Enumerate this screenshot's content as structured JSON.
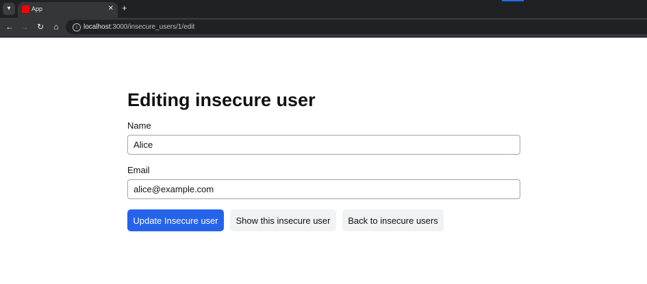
{
  "browser": {
    "tab_menu_icon": "chevron-down-icon",
    "tab_title": "App",
    "tab_close": "✕",
    "new_tab": "+",
    "url_host": "localhost",
    "url_path": ":3000/insecure_users/1/edit",
    "colors": {
      "favicon": "#ff0000",
      "tabbar_bg": "#202124",
      "toolbar_bg": "#35363a"
    }
  },
  "page": {
    "title": "Editing insecure user",
    "form": {
      "name_label": "Name",
      "name_value": "Alice",
      "email_label": "Email",
      "email_value": "alice@example.com"
    },
    "buttons": {
      "update": "Update Insecure user",
      "show": "Show this insecure user",
      "back": "Back to insecure users"
    },
    "colors": {
      "primary_button": "#2563eb",
      "secondary_button": "#f1f2f4"
    }
  }
}
